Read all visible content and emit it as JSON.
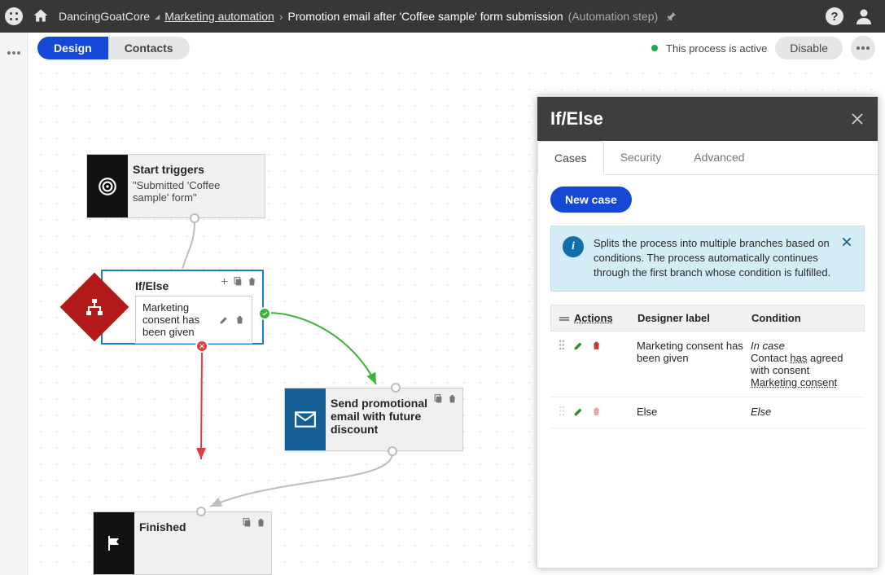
{
  "breadcrumb": {
    "site": "DancingGoatCore",
    "section": "Marketing automation",
    "title": "Promotion email after 'Coffee sample' form submission",
    "parens": "(Automation step)"
  },
  "tabs": {
    "design": "Design",
    "contacts": "Contacts"
  },
  "status": {
    "text": "This process is active",
    "disable": "Disable"
  },
  "nodes": {
    "start": {
      "title": "Start triggers",
      "sub": "\"Submitted 'Coffee sample' form\""
    },
    "ifelse": {
      "title": "If/Else",
      "cond": "Marketing consent has been given"
    },
    "send": {
      "title": "Send promotional email with future discount"
    },
    "fin": {
      "title": "Finished"
    }
  },
  "panel": {
    "title": "If/Else",
    "tabs": {
      "cases": "Cases",
      "security": "Security",
      "advanced": "Advanced"
    },
    "new_case": "New case",
    "info": "Splits the process into multiple branches based on conditions. The process automatically continues through the first branch whose condition is fulfilled.",
    "headers": {
      "actions": "Actions",
      "label": "Designer label",
      "condition": "Condition"
    },
    "rows": [
      {
        "label": "Marketing consent has been given",
        "cond_italic": "In case",
        "cond_line2a": "Contact ",
        "cond_line2b": "has",
        "cond_line2c": " agreed with consent ",
        "cond_line3": "Marketing consent"
      },
      {
        "label": "Else",
        "cond_italic": "Else"
      }
    ]
  }
}
